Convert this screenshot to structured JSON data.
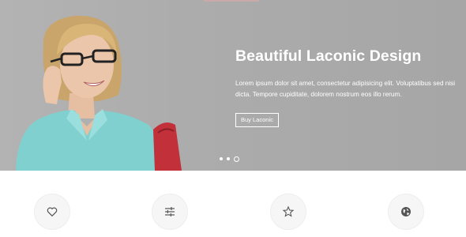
{
  "hero": {
    "title": "Beautiful Laconic Design",
    "text": "Lorem ipsum dolor sit amet, consectetur adipisicing elit. Voluptatibus sed nisi dicta. Tempore cupiditate, dolorem nostrum eos illo rerum.",
    "button_label": "Buy Laconic",
    "slides_total": 3,
    "active_slide": 3
  },
  "features": [
    {
      "icon": "heart-icon"
    },
    {
      "icon": "sliders-icon"
    },
    {
      "icon": "star-icon"
    },
    {
      "icon": "globe-icon"
    }
  ],
  "colors": {
    "hero_background": "#acacac",
    "text_on_hero": "#ffffff",
    "icon_color": "#555555"
  }
}
